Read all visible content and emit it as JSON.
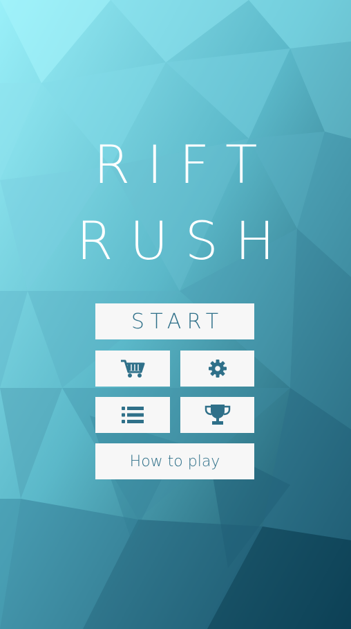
{
  "title": {
    "line1": "RIFT",
    "line2": "RUSH"
  },
  "menu": {
    "start_label": "START",
    "how_to_play_label": "How to play",
    "icons": {
      "shop": "shopping-cart-icon",
      "settings": "gear-icon",
      "list": "list-icon",
      "achievements": "trophy-icon"
    }
  },
  "colors": {
    "background_top": "#8fe9f5",
    "background_bottom": "#0b4a5e",
    "button_bg": "#f7f7f7",
    "button_fg": "#2f7089",
    "title_color": "#ffffff"
  }
}
